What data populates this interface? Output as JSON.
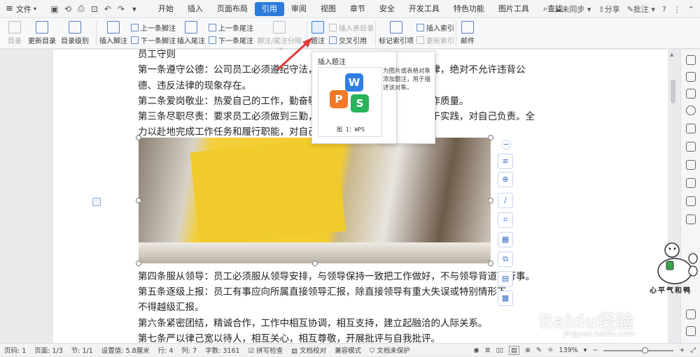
{
  "menubar": {
    "file_label": "文件",
    "tabs": [
      "开始",
      "插入",
      "页面布局",
      "引用",
      "审阅",
      "视图",
      "章节",
      "安全",
      "开发工具",
      "特色功能",
      "图片工具"
    ],
    "active_tab": "引用",
    "search_label": "查找",
    "sync_label": "未同步",
    "share_label": "分享",
    "comment_label": "批注"
  },
  "ribbon": {
    "toc": "目录",
    "update_toc": "更新目录",
    "toc_level": "目录级别",
    "insert_footnote": "插入脚注",
    "prev_footnote": "上一条脚注",
    "next_footnote": "下一条脚注",
    "insert_endnote": "插入尾注",
    "prev_endnote": "上一条尾注",
    "next_endnote": "下一条尾注",
    "footnote_separator": "脚注/尾注分隔线",
    "caption": "题注",
    "insert_table_of_figures": "插入表目录",
    "cross_reference": "交叉引用",
    "mark_index": "标记索引项",
    "insert_index": "插入索引",
    "update_index": "更新索引",
    "mail": "邮件"
  },
  "popup": {
    "title": "插入题注",
    "description": "为图片或表格对象添加题注，用于描述该对象。",
    "preview_caption": "图 1：WPS",
    "tile_letters": [
      "W",
      "P",
      "S"
    ]
  },
  "document": {
    "lines": [
      "员工守则",
      "第一条遵守公德：公司员工必须遵纪守法，维护社会公德，严守劳动纪律，绝对不允许违背公",
      "德、违反法律的现象存在。",
      "第二条爱岗敬业：热爱自己的工作，勤奋敬业，不断提高工作效率和工作质量。",
      "第三条尽职尽责：要求员工必须做到三勤，即勤于学习、勤于思考、勤于实践，对自己负责。全",
      "力以赴地完成工作任务和履行职能，对自己的工作结果负责。",
      "第四条服从领导：员工必须服从领导安排，与领导保持一致把工作做好，不与领导背道而行事。",
      "第五条逐级上报：员工有事应向所属直接领导汇报，除直接领导有重大失误或特别情形下，",
      "不得越级汇报。",
      "第六条紧密团结，精诚合作，工作中相互协调，相互支持，建立起融洽的人际关系。",
      "第七条严以律己宽以待人，相互关心，相互尊敬，开展批评与自我批评。"
    ]
  },
  "statusbar": {
    "page_no": "页码: 1",
    "pages": "页面: 1/3",
    "section": "节: 1/1",
    "setting": "设置值: 5.8厘米",
    "row": "行: 4",
    "col": "列: 7",
    "words": "字数: 3161",
    "spell": "拼写检查",
    "proof": "文档校对",
    "compat": "兼容模式",
    "protect": "文档未保护",
    "zoom": "139%"
  },
  "watermark": {
    "brand": "Baidu经验",
    "url": "jingyan.baidu.com",
    "author": "心平气和鸭"
  },
  "colors": {
    "accent": "#2b7bdb",
    "arrow": "#e03a3a",
    "wps_blue": "#2f7fe6",
    "wps_orange": "#f07a2a",
    "wps_green": "#28b35a"
  }
}
